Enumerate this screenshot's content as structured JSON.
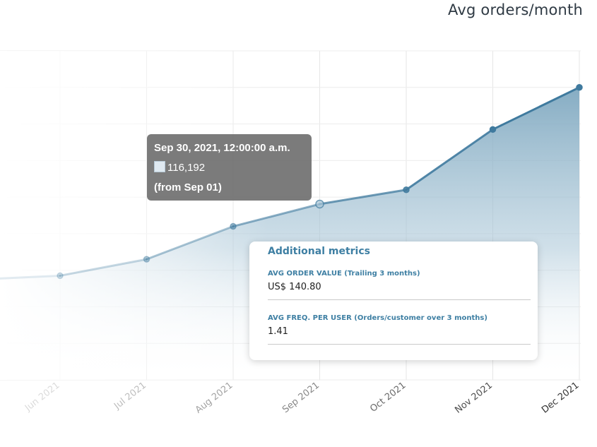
{
  "chart_data": {
    "type": "area",
    "title": "Avg orders/month",
    "categories": [
      "Jun 2021",
      "Jul 2021",
      "Aug 2021",
      "Sep 2021",
      "Oct 2021",
      "Nov 2021",
      "Dec 2021"
    ],
    "values": [
      77000,
      86000,
      104000,
      116192,
      124000,
      157000,
      180000
    ],
    "ylim": [
      20000,
      200000
    ],
    "colors": {
      "line": "#3f7a9e",
      "fill_top": "#8fb5cb"
    },
    "tooltip": {
      "date": "Sep 30, 2021, 12:00:00 a.m.",
      "value": "116,192",
      "range": "(from Sep 01)"
    }
  },
  "metrics": {
    "title": "Additional metrics",
    "items": [
      {
        "label": "AVG ORDER VALUE (Trailing 3 months)",
        "value": "US$ 140.80"
      },
      {
        "label": "AVG FREQ. PER USER (Orders/customer over 3 months)",
        "value": "1.41"
      }
    ]
  }
}
